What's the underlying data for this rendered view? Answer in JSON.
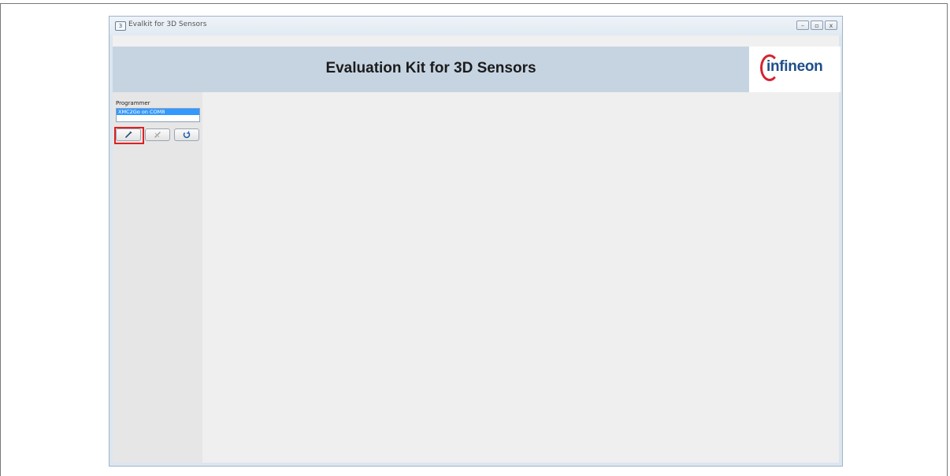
{
  "window": {
    "title": "Evalkit for 3D Sensors",
    "controls": [
      {
        "name": "minimize",
        "glyph": "–"
      },
      {
        "name": "maximize",
        "glyph": "▫"
      },
      {
        "name": "close",
        "glyph": "x"
      }
    ]
  },
  "header": {
    "title": "Evaluation Kit for 3D Sensors",
    "logo_text": "infineon",
    "banner_color": "#c6d4e2"
  },
  "sidebar": {
    "programmer_label": "Programmer",
    "programmer_items": [
      "XMC2Go on COM8"
    ],
    "selected_index": 0,
    "buttons": [
      {
        "name": "connect",
        "icon": "connect-plug-icon",
        "highlighted": true
      },
      {
        "name": "disconnect",
        "icon": "disconnect-plug-icon",
        "highlighted": false
      },
      {
        "name": "refresh",
        "icon": "refresh-icon",
        "highlighted": false
      }
    ]
  },
  "colors": {
    "highlight": "#e02020",
    "selection": "#3399ff",
    "logo": "#1f4e8c",
    "logo_accent": "#d5232f"
  }
}
